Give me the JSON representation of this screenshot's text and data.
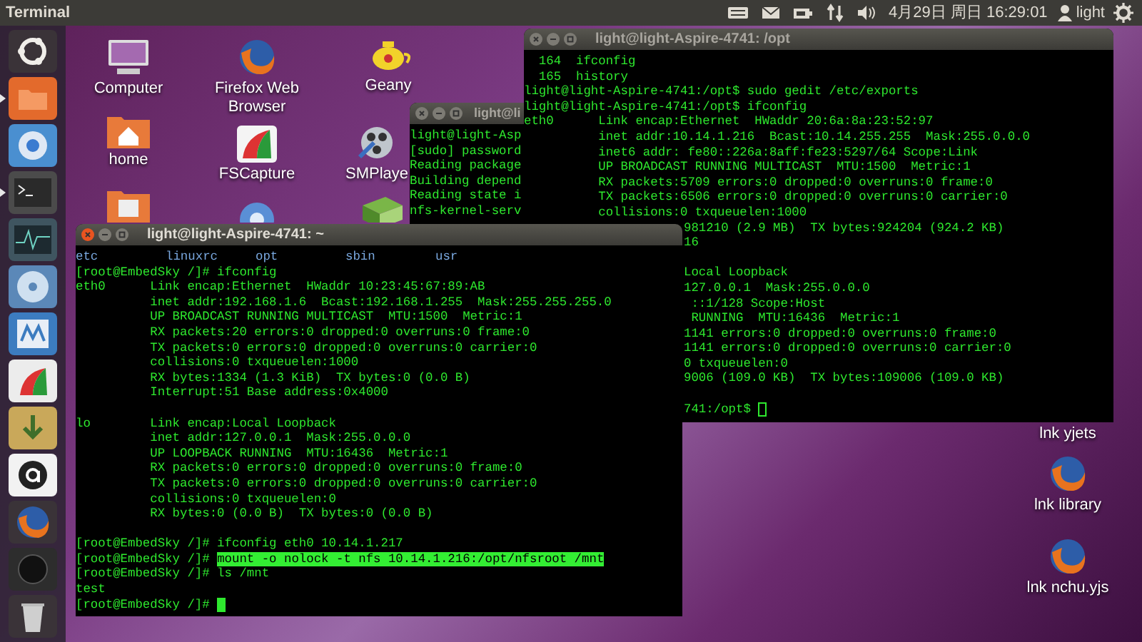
{
  "top_panel": {
    "app_title": "Terminal",
    "clock": "4月29日 周日 16:29:01",
    "user": "light"
  },
  "launcher": [
    {
      "kind": "ubuntu",
      "running": false
    },
    {
      "kind": "folder",
      "running": true
    },
    {
      "kind": "chromium",
      "running": false
    },
    {
      "kind": "terminal",
      "running": true
    },
    {
      "kind": "monitor",
      "running": false
    },
    {
      "kind": "disc",
      "running": false
    },
    {
      "kind": "editor",
      "running": false
    },
    {
      "kind": "fscapture",
      "running": false
    },
    {
      "kind": "download",
      "running": false
    },
    {
      "kind": "ring",
      "running": false
    },
    {
      "kind": "firefox",
      "running": false
    },
    {
      "kind": "dark",
      "running": false
    },
    {
      "kind": "trash",
      "running": false
    }
  ],
  "desktop_icons": [
    {
      "kind": "computer",
      "label": "Computer"
    },
    {
      "kind": "firefox",
      "label": "Firefox Web Browser"
    },
    {
      "kind": "teapot",
      "label": "Geany"
    },
    {
      "kind": "home",
      "label": "home"
    },
    {
      "kind": "fscapture",
      "label": "FSCapture"
    },
    {
      "kind": "reel",
      "label": "SMPlaye"
    },
    {
      "kind": "picture-folder"
    },
    {
      "kind": "chromium"
    },
    {
      "kind": "book"
    },
    {
      "kind": "none",
      "label": "lnk yjets"
    },
    {
      "kind": "firefox",
      "label": "lnk library"
    },
    {
      "kind": "firefox",
      "label": "lnk nchu.yjs"
    }
  ],
  "windows": [
    {
      "title": "light@li",
      "focused": false,
      "cursor": false,
      "lines": [
        {
          "kind": "text",
          "text": "light@light-Asp"
        },
        {
          "kind": "text",
          "text": "[sudo] password"
        },
        {
          "kind": "text",
          "text": "Reading package"
        },
        {
          "kind": "text",
          "text": "Building depend"
        },
        {
          "kind": "text",
          "text": "Reading state i"
        },
        {
          "kind": "text",
          "text": "nfs-kernel-serv"
        }
      ]
    },
    {
      "title": "light@light-Aspire-4741: /opt",
      "focused": false,
      "cursor": true,
      "lines": [
        {
          "kind": "text",
          "text": "  164  ifconfig"
        },
        {
          "kind": "text",
          "text": "  165  history"
        },
        {
          "kind": "text",
          "text": "light@light-Aspire-4741:/opt$ sudo gedit /etc/exports"
        },
        {
          "kind": "text",
          "text": "light@light-Aspire-4741:/opt$ ifconfig"
        },
        {
          "kind": "text",
          "text": "eth0      Link encap:Ethernet  HWaddr 20:6a:8a:23:52:97"
        },
        {
          "kind": "text",
          "text": "          inet addr:10.14.1.216  Bcast:10.14.255.255  Mask:255.0.0.0"
        },
        {
          "kind": "text",
          "text": "          inet6 addr: fe80::226a:8aff:fe23:5297/64 Scope:Link"
        },
        {
          "kind": "text",
          "text": "          UP BROADCAST RUNNING MULTICAST  MTU:1500  Metric:1"
        },
        {
          "kind": "text",
          "text": "          RX packets:5709 errors:0 dropped:0 overruns:0 frame:0"
        },
        {
          "kind": "text",
          "text": "          TX packets:6506 errors:0 dropped:0 overruns:0 carrier:0"
        },
        {
          "kind": "text",
          "text": "          collisions:0 txqueuelen:1000"
        }
      ],
      "partly_hidden_lines": [
        {
          "kind": "text",
          "text": "981210 (2.9 MB)  TX bytes:924204 (924.2 KB)"
        },
        {
          "kind": "text",
          "text": "16"
        },
        {
          "kind": "blank"
        },
        {
          "kind": "text",
          "text": "Local Loopback"
        },
        {
          "kind": "text",
          "text": "127.0.0.1  Mask:255.0.0.0"
        },
        {
          "kind": "text",
          "text": " ::1/128 Scope:Host"
        },
        {
          "kind": "text",
          "text": " RUNNING  MTU:16436  Metric:1"
        },
        {
          "kind": "text",
          "text": "1141 errors:0 dropped:0 overruns:0 frame:0"
        },
        {
          "kind": "text",
          "text": "1141 errors:0 dropped:0 overruns:0 carrier:0"
        },
        {
          "kind": "text",
          "text": "0 txqueuelen:0"
        },
        {
          "kind": "text",
          "text": "9006 (109.0 KB)  TX bytes:109006 (109.0 KB)"
        },
        {
          "kind": "blank"
        },
        {
          "kind": "text",
          "text": "741:/opt$ "
        }
      ]
    },
    {
      "title": "light@light-Aspire-4741: ~",
      "focused": true,
      "cursor": true,
      "lines": [
        {
          "kind": "listing",
          "items": [
            "etc",
            "linuxrc",
            "opt",
            "sbin",
            "usr"
          ]
        },
        {
          "kind": "text",
          "text": "[root@EmbedSky /]# ifconfig"
        },
        {
          "kind": "text",
          "text": "eth0      Link encap:Ethernet  HWaddr 10:23:45:67:89:AB"
        },
        {
          "kind": "text",
          "text": "          inet addr:192.168.1.6  Bcast:192.168.1.255  Mask:255.255.255.0"
        },
        {
          "kind": "text",
          "text": "          UP BROADCAST RUNNING MULTICAST  MTU:1500  Metric:1"
        },
        {
          "kind": "text",
          "text": "          RX packets:20 errors:0 dropped:0 overruns:0 frame:0"
        },
        {
          "kind": "text",
          "text": "          TX packets:0 errors:0 dropped:0 overruns:0 carrier:0"
        },
        {
          "kind": "text",
          "text": "          collisions:0 txqueuelen:1000"
        },
        {
          "kind": "text",
          "text": "          RX bytes:1334 (1.3 KiB)  TX bytes:0 (0.0 B)"
        },
        {
          "kind": "text",
          "text": "          Interrupt:51 Base address:0x4000"
        },
        {
          "kind": "blank"
        },
        {
          "kind": "text",
          "text": "lo        Link encap:Local Loopback"
        },
        {
          "kind": "text",
          "text": "          inet addr:127.0.0.1  Mask:255.0.0.0"
        },
        {
          "kind": "text",
          "text": "          UP LOOPBACK RUNNING  MTU:16436  Metric:1"
        },
        {
          "kind": "text",
          "text": "          RX packets:0 errors:0 dropped:0 overruns:0 frame:0"
        },
        {
          "kind": "text",
          "text": "          TX packets:0 errors:0 dropped:0 overruns:0 carrier:0"
        },
        {
          "kind": "text",
          "text": "          collisions:0 txqueuelen:0"
        },
        {
          "kind": "text",
          "text": "          RX bytes:0 (0.0 B)  TX bytes:0 (0.0 B)"
        },
        {
          "kind": "blank"
        },
        {
          "kind": "text",
          "text": "[root@EmbedSky /]# ifconfig eth0 10.14.1.217"
        },
        {
          "kind": "command",
          "prompt": "[root@EmbedSky /]# ",
          "command": "mount -o nolock -t nfs 10.14.1.216:/opt/nfsroot /mnt",
          "selected": true
        },
        {
          "kind": "text",
          "text": "[root@EmbedSky /]# ls /mnt"
        },
        {
          "kind": "text",
          "text": "test"
        },
        {
          "kind": "text",
          "text": "[root@EmbedSky /]# "
        }
      ]
    }
  ]
}
